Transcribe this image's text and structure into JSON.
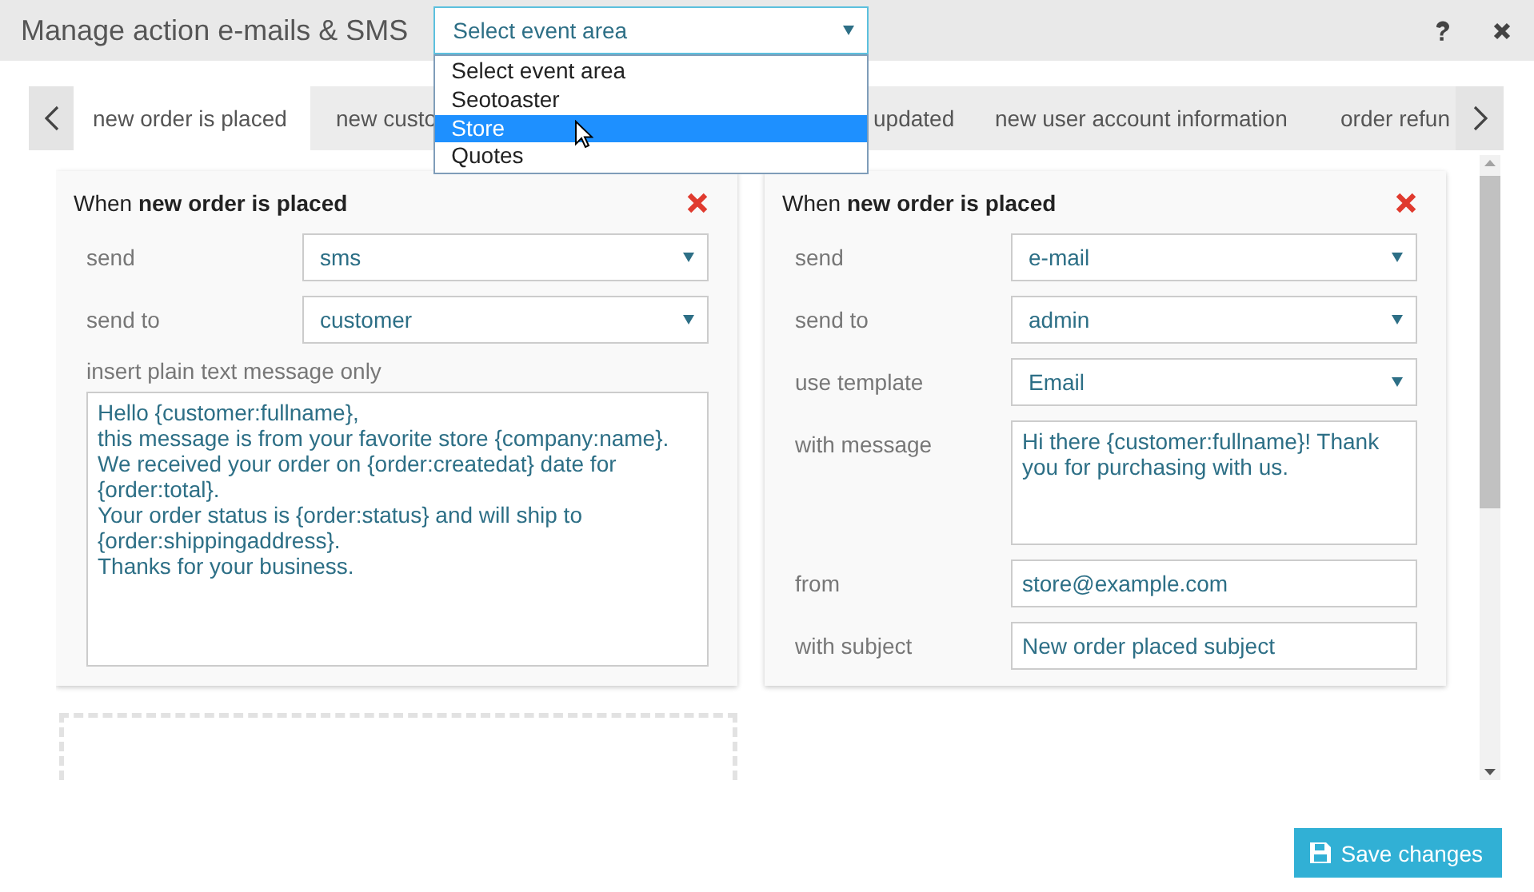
{
  "window": {
    "title": "Manage action e-mails & SMS"
  },
  "event_area_select": {
    "value": "Select event area",
    "expanded": true,
    "options": [
      {
        "label": "Select event area",
        "highlighted": false
      },
      {
        "label": "Seotoaster",
        "highlighted": false
      },
      {
        "label": "Store",
        "highlighted": true
      },
      {
        "label": "Quotes",
        "highlighted": false
      }
    ]
  },
  "tabs": [
    {
      "label": "new order is placed",
      "selected": true
    },
    {
      "label": "new custo",
      "selected": false
    },
    {
      "label": "updated",
      "selected": false
    },
    {
      "label": "new user account information",
      "selected": false
    },
    {
      "label": "order refun",
      "selected": false
    }
  ],
  "cards": [
    {
      "title": "When **new order is placed**",
      "fields": [
        {
          "kind": "select",
          "label": "send",
          "value": "sms"
        },
        {
          "kind": "select",
          "label": "send to",
          "value": "customer"
        },
        {
          "kind": "stacked-textarea",
          "label": "insert plain text message only",
          "value": "Hello {customer:fullname},\nthis message is from your favorite store {company:name}.\nWe received your order on {order:createdat} date for\n{order:total}.\nYour order status is {order:status} and will ship to\n{order:shippingaddress}.\nThanks for your business."
        }
      ]
    },
    {
      "title": "When **new order is placed**",
      "fields": [
        {
          "kind": "select",
          "label": "send",
          "value": "e-mail"
        },
        {
          "kind": "select",
          "label": "send to",
          "value": "admin"
        },
        {
          "kind": "select",
          "label": "use template",
          "value": "Email"
        },
        {
          "kind": "textarea",
          "label": "with message",
          "value": "Hi there {customer:fullname}! Thank you for purchasing with us."
        },
        {
          "kind": "input",
          "label": "from",
          "value": "store@example.com"
        },
        {
          "kind": "input",
          "label": "with subject",
          "value": "New order placed subject"
        }
      ]
    }
  ],
  "save_button": {
    "label": "Save changes"
  }
}
